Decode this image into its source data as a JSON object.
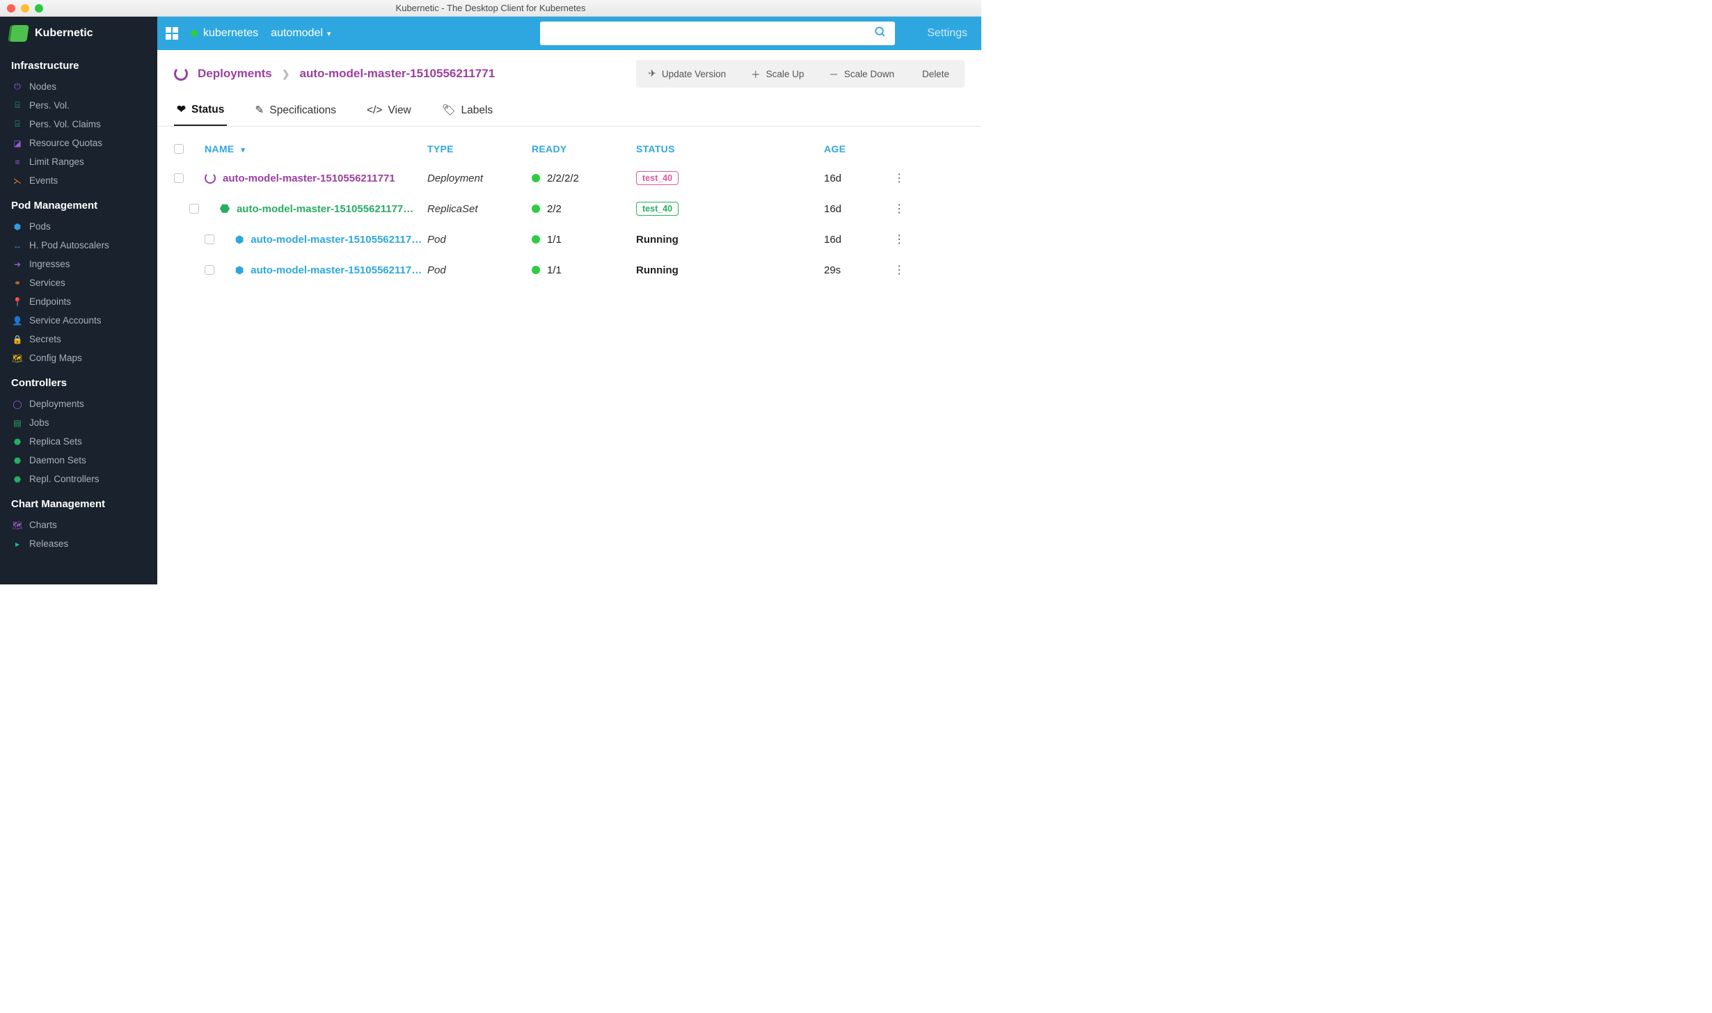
{
  "window": {
    "title": "Kubernetic - The Desktop Client for Kubernetes"
  },
  "brand": {
    "name": "Kubernetic"
  },
  "topbar": {
    "context": "kubernetes",
    "namespace": "automodel",
    "settings": "Settings"
  },
  "sidebar": {
    "sections": [
      {
        "title": "Infrastructure",
        "items": [
          {
            "label": "Nodes",
            "icon": "⏻",
            "color": "c-purple"
          },
          {
            "label": "Pers. Vol.",
            "icon": "⌸",
            "color": "c-teal"
          },
          {
            "label": "Pers. Vol. Claims",
            "icon": "⌸",
            "color": "c-teal"
          },
          {
            "label": "Resource Quotas",
            "icon": "◪",
            "color": "c-purple"
          },
          {
            "label": "Limit Ranges",
            "icon": "≡",
            "color": "c-purple"
          },
          {
            "label": "Events",
            "icon": "⋋",
            "color": "c-orange"
          }
        ]
      },
      {
        "title": "Pod Management",
        "items": [
          {
            "label": "Pods",
            "icon": "⬢",
            "color": "c-blue"
          },
          {
            "label": "H. Pod Autoscalers",
            "icon": "↔",
            "color": "c-blue"
          },
          {
            "label": "Ingresses",
            "icon": "➜",
            "color": "c-purple"
          },
          {
            "label": "Services",
            "icon": "⚭",
            "color": "c-orange"
          },
          {
            "label": "Endpoints",
            "icon": "📍",
            "color": "c-orange"
          },
          {
            "label": "Service Accounts",
            "icon": "👤",
            "color": "c-red"
          },
          {
            "label": "Secrets",
            "icon": "🔒",
            "color": "c-orange"
          },
          {
            "label": "Config Maps",
            "icon": "🗺",
            "color": "c-yellow"
          }
        ]
      },
      {
        "title": "Controllers",
        "items": [
          {
            "label": "Deployments",
            "icon": "◯",
            "color": "c-purple"
          },
          {
            "label": "Jobs",
            "icon": "▤",
            "color": "c-green"
          },
          {
            "label": "Replica Sets",
            "icon": "⬣",
            "color": "c-green"
          },
          {
            "label": "Daemon Sets",
            "icon": "⬣",
            "color": "c-green"
          },
          {
            "label": "Repl. Controllers",
            "icon": "⬣",
            "color": "c-green"
          }
        ]
      },
      {
        "title": "Chart Management",
        "items": [
          {
            "label": "Charts",
            "icon": "🗺",
            "color": "c-purple"
          },
          {
            "label": "Releases",
            "icon": "▸",
            "color": "c-teal"
          }
        ]
      }
    ]
  },
  "breadcrumb": {
    "root": "Deployments",
    "current": "auto-model-master-1510556211771"
  },
  "actions": {
    "update": "Update Version",
    "scaleup": "Scale Up",
    "scaledown": "Scale Down",
    "delete": "Delete"
  },
  "tabs": [
    {
      "label": "Status",
      "icon": "❤"
    },
    {
      "label": "Specifications",
      "icon": "✎"
    },
    {
      "label": "View",
      "icon": "</>"
    },
    {
      "label": "Labels",
      "icon": "🏷"
    }
  ],
  "columns": {
    "name": "NAME",
    "type": "TYPE",
    "ready": "READY",
    "status": "STATUS",
    "age": "AGE"
  },
  "rows": [
    {
      "indent": 0,
      "kind": "deploy",
      "name": "auto-model-master-1510556211771",
      "type": "Deployment",
      "ready": "2/2/2/2",
      "status_badge": "test_40",
      "badge_style": "",
      "age": "16d",
      "link": "link-purple"
    },
    {
      "indent": 1,
      "kind": "rs",
      "name": "auto-model-master-151055621177…",
      "type": "ReplicaSet",
      "ready": "2/2",
      "status_badge": "test_40",
      "badge_style": "green",
      "age": "16d",
      "link": "link-green"
    },
    {
      "indent": 2,
      "kind": "pod",
      "name": "auto-model-master-15105562117…",
      "type": "Pod",
      "ready": "1/1",
      "status_text": "Running",
      "age": "16d",
      "link": "link-blue"
    },
    {
      "indent": 2,
      "kind": "pod",
      "name": "auto-model-master-15105562117…",
      "type": "Pod",
      "ready": "1/1",
      "status_text": "Running",
      "age": "29s",
      "link": "link-blue"
    }
  ]
}
